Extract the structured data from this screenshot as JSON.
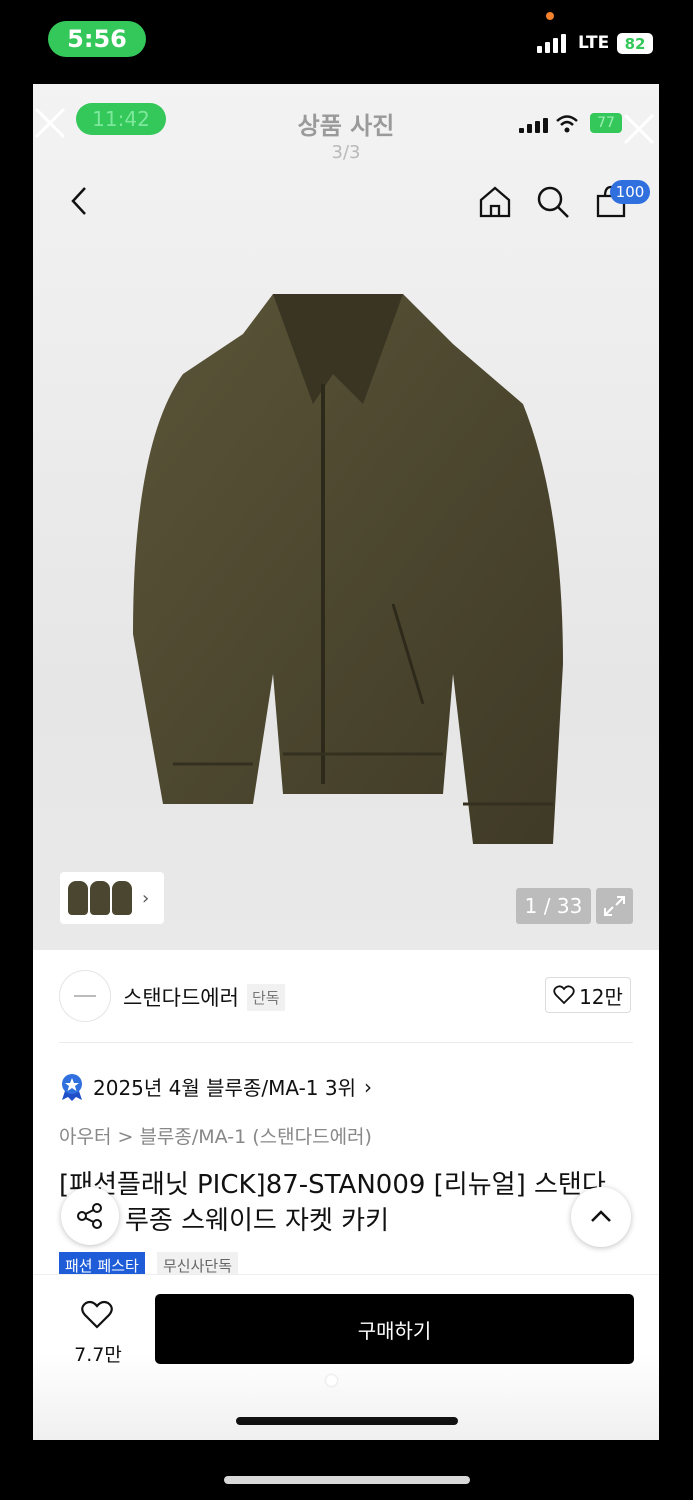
{
  "outer_status": {
    "time": "5:56",
    "network": "LTE",
    "battery": "82"
  },
  "inner_status": {
    "time": "11:42",
    "battery": "77"
  },
  "viewer": {
    "title": "상품 사진",
    "page_indicator": "3/3"
  },
  "cart": {
    "count": "100"
  },
  "gallery": {
    "counter": "1 / 33",
    "product_color": "#4b4630"
  },
  "brand": {
    "name": "스탠다드에러",
    "tag": "단독",
    "likes": "12만"
  },
  "ranking": {
    "text": "2025년 4월 블루종/MA-1 3위"
  },
  "category": {
    "text": "아우터 > 블루종/MA-1 (스탠다드에러)"
  },
  "product": {
    "title_line1": "[패션플래닛 PICK]87-STAN009 [리뉴얼] 스탠다",
    "title_line2": "루종 스웨이드 자켓 카키",
    "tags": [
      "패션 페스타",
      "무신사단독"
    ]
  },
  "bottom_bar": {
    "wish_count": "7.7만",
    "buy_label": "구매하기"
  },
  "colors": {
    "accent_blue": "#2f6fde",
    "status_green": "#34c759"
  }
}
